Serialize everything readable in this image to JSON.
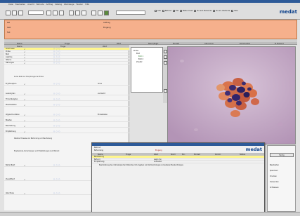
{
  "app": {
    "logo": "medat",
    "menu": [
      "Datei",
      "Bearbeiten",
      "Ansicht",
      "Befunde",
      "Auftrag",
      "Katalog",
      "Werkzeuge",
      "Fenster",
      "Hilfe"
    ]
  },
  "toolbar": {
    "filters": [
      "Alle",
      "Befund",
      "Ext",
      "Befund ext",
      "Zu ext. Befunde",
      "Zu erl. Befunde",
      "Pers"
    ]
  },
  "patient": {
    "name": "",
    "case_number": "",
    "labels": [
      "Pat",
      "Geb",
      "Fall",
      "Auftrag",
      "Eingang"
    ]
  },
  "columns": {
    "name": "Name",
    "frage": "Frage",
    "wert": "Wert",
    "norm": "Norm/Ergb.",
    "einheit": "Einheit",
    "abnormal": "Abnormal",
    "kommentar": "Kommentar",
    "status": "B. Befund"
  },
  "left_panel": {
    "rows": [
      {
        "label": "Anamnese",
        "value": "",
        "highlight": true
      },
      {
        "label": "Probe",
        "value": ""
      },
      {
        "label": "Blut",
        "value": ""
      },
      {
        "label": "Lipämie",
        "value": ""
      },
      {
        "label": "Ikterus",
        "value": ""
      },
      {
        "label": "Hämolyse",
        "value": ""
      },
      {
        "label": "Erythrozyten",
        "value": "ohne"
      },
      {
        "label": "Leukozyten",
        "value": "vermehrt"
      },
      {
        "label": "Thrombozyten",
        "value": ""
      },
      {
        "label": "Plasmazellen",
        "value": ""
      },
      {
        "label": "Atypische Zellen",
        "value": "Einzelzellen"
      },
      {
        "label": "Blasten",
        "value": ""
      },
      {
        "label": "Beurteilung",
        "value": ""
      },
      {
        "label": "Empfehlung",
        "value": ""
      },
      {
        "label": "Befundtext",
        "value": ""
      },
      {
        "label": "Zusatztext",
        "value": ""
      },
      {
        "label": "Abschluss",
        "value": ""
      }
    ],
    "text_1": "Kurze Notiz zur Morphologie der Probe",
    "text_2": "Weitere Hinweise zur Befundung und Beurteilung",
    "text_3": "Ergänzende Anmerkungen und Empfehlungen zum Befund"
  },
  "tree": {
    "root": "Probe",
    "items": [
      "Blut",
      "Bild 1",
      "Bild 2",
      "Zusatz"
    ]
  },
  "dialog": {
    "title": "Befund",
    "logo": "medat",
    "subtitle": "Befundung",
    "eingang_label": "Eingang",
    "columns": [
      "Name",
      "Frage",
      "Wert",
      "Norm",
      "Ein.",
      "Einheit",
      "Komm.",
      "Status"
    ],
    "rows": [
      {
        "name": "Beurteilung",
        "wert": "",
        "highlight": true
      },
      {
        "name": "Befund",
        "wert": "weiß ohn"
      },
      {
        "name": "Empfehlung",
        "wert": "zufrieden"
      }
    ],
    "text": "Beschreibung des mikroskopischen Befundes mit Angaben zur Zellmorphologie und weiteren Beobachtungen."
  },
  "right_panel": {
    "button": "Fertig",
    "items": [
      "Bearbeiten",
      "Speichern",
      "Drucken",
      "Versenden",
      "Schliessen"
    ]
  }
}
